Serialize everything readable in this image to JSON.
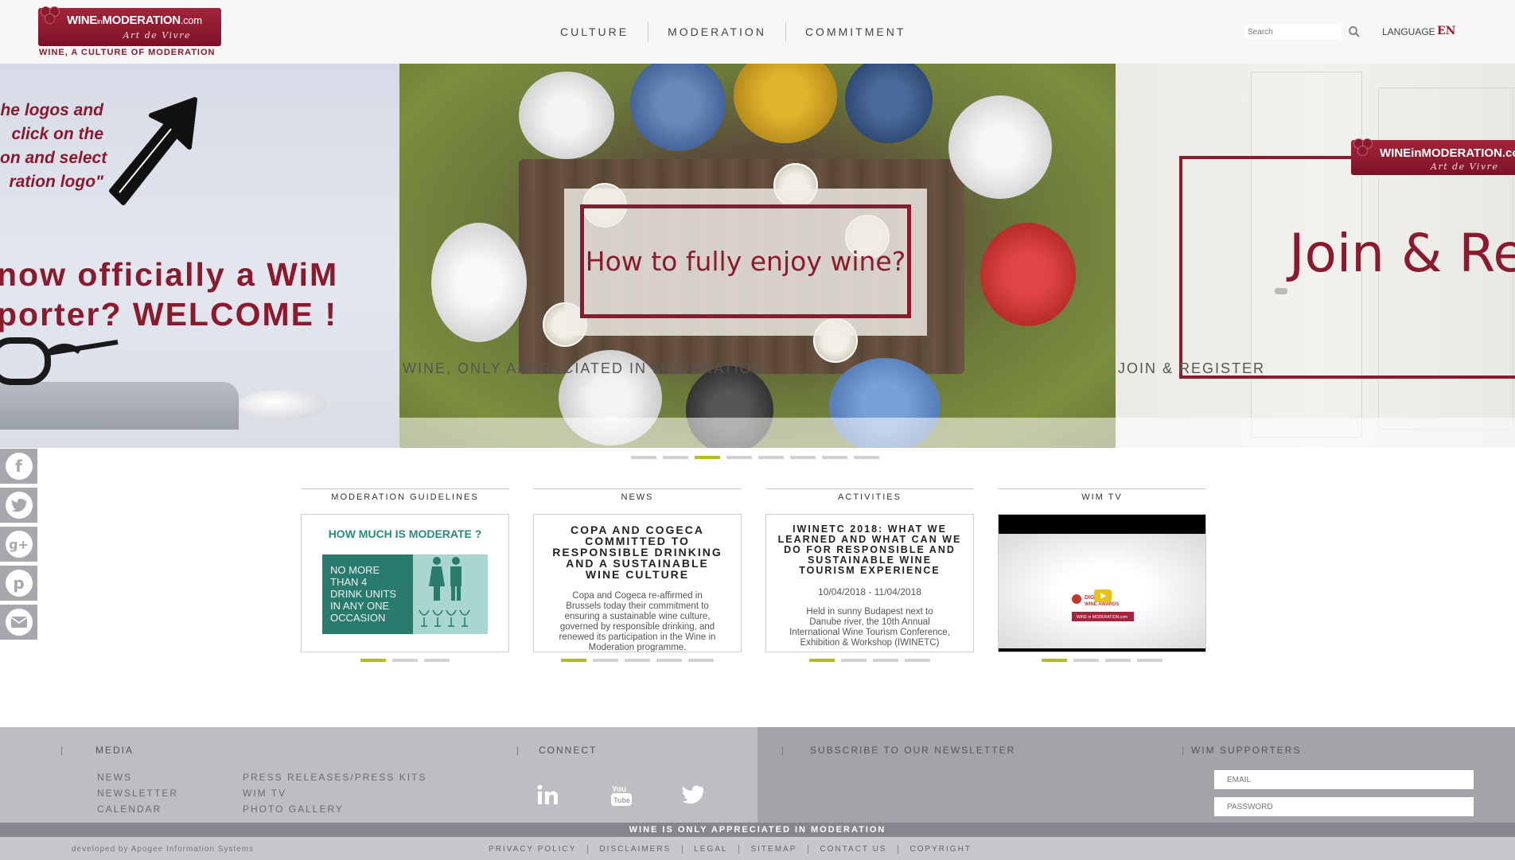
{
  "header": {
    "logo": {
      "title_wine": "WINE",
      "title_in": "in",
      "title_moderation": "MODERATION",
      "title_com": ".com",
      "subtitle": "Art de Vivre",
      "tagline": "WINE, A CULTURE OF MODERATION"
    },
    "nav": [
      "CULTURE",
      "MODERATION",
      "COMMITMENT"
    ],
    "search_placeholder": "Search",
    "language_label": "LANGUAGE",
    "language_value": "EN"
  },
  "hero": {
    "left": {
      "note_lines": [
        "he logos and",
        "click on the",
        "on and select",
        "ration logo\""
      ],
      "welcome_lines": [
        "now officially a WiM",
        "porter? WELCOME !"
      ]
    },
    "center": {
      "title": "How to fully enjoy wine?",
      "caption": "WINE, ONLY APPRECIATED IN MODERATION"
    },
    "right": {
      "logo_title": "WINEinMODERATION.co",
      "logo_sub": "Art de Vivre",
      "title": "Join & Re",
      "caption": "JOIN & REGISTER"
    },
    "dot_count": 8,
    "active_dot": 2
  },
  "social": [
    "facebook-icon",
    "twitter-icon",
    "google-plus-icon",
    "pinterest-icon",
    "email-icon"
  ],
  "columns": {
    "guidelines": {
      "header": "MODERATION GUIDELINES",
      "title": "HOW MUCH IS MODERATE ?",
      "panel_lines": [
        "NO MORE",
        "THAN 4",
        "DRINK UNITS",
        "IN ANY ONE",
        "OCCASION"
      ]
    },
    "news": {
      "header": "NEWS",
      "title_lines": [
        "COPA AND COGECA",
        "COMMITTED TO",
        "RESPONSIBLE DRINKING",
        "AND A SUSTAINABLE",
        "WINE CULTURE"
      ],
      "body_lines": [
        "Copa and Cogeca re-affirmed in",
        "Brussels today their commitment to",
        "ensuring a sustainable wine culture,",
        "governed by responsible drinking, and",
        "renewed its participation in the Wine in",
        "Moderation programme."
      ]
    },
    "activities": {
      "header": "ACTIVITIES",
      "title_lines": [
        "IWINETC 2018: WHAT WE",
        "LEARNED AND WHAT CAN WE",
        "DO FOR RESPONSIBLE AND",
        "SUSTAINABLE WINE",
        "TOURISM EXPERIENCE"
      ],
      "date": "10/04/2018 - 11/04/2018",
      "body_lines": [
        "Held in sunny Budapest next to",
        "Danube river, the 10th Annual",
        "International Wine Tourism Conference,",
        "Exhibition & Workshop (IWINETC)"
      ]
    },
    "wimtv": {
      "header": "WIM TV",
      "video_logo_line1": "DIGITAL",
      "video_logo_line2": "WINE AWARDS",
      "video_logo_line3": "WINE in MODERATION.com"
    }
  },
  "footer": {
    "media_header": "MEDIA",
    "media_links_col1": [
      "NEWS",
      "NEWSLETTER",
      "CALENDAR"
    ],
    "media_links_col2": [
      "PRESS RELEASES/PRESS KITS",
      "WIM TV",
      "PHOTO GALLERY"
    ],
    "connect_header": "CONNECT",
    "newsletter_header": "SUBSCRIBE TO OUR NEWSLETTER",
    "supporters_header": "WIM SUPPORTERS",
    "email_placeholder": "EMAIL",
    "password_placeholder": "PASSWORD",
    "strip_text": "WINE IS ONLY APPRECIATED IN MODERATION",
    "developer": "developed by Apogee Information Systems",
    "legal_links": [
      "PRIVACY POLICY",
      "DISCLAIMERS",
      "LEGAL",
      "SITEMAP",
      "CONTACT US",
      "COPYRIGHT"
    ]
  },
  "colors": {
    "brand": "#8a1a2e",
    "accent_dot": "#b3bd1b",
    "guideline_teal": "#2a7b6e"
  }
}
